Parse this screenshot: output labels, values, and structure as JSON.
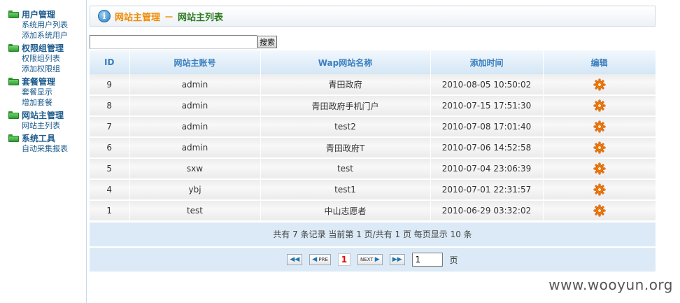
{
  "sidebar": {
    "groups": [
      {
        "title": "用户管理",
        "items": [
          "系统用户列表",
          "添加系统用户"
        ]
      },
      {
        "title": "权限组管理",
        "items": [
          "权限组列表",
          "添加权限组"
        ]
      },
      {
        "title": "套餐管理",
        "items": [
          "套餐显示",
          "增加套餐"
        ]
      },
      {
        "title": "网站主管理",
        "items": [
          "网站主列表"
        ]
      },
      {
        "title": "系统工具",
        "items": [
          "自动采集报表"
        ]
      }
    ]
  },
  "breadcrumb": {
    "section": "网站主管理",
    "separator": "－",
    "page": "网站主列表"
  },
  "search": {
    "value": "",
    "button_label": "搜索"
  },
  "table": {
    "headers": [
      "ID",
      "网站主账号",
      "Wap网站名称",
      "添加时间",
      "编辑"
    ],
    "rows": [
      {
        "id": "9",
        "account": "admin",
        "site": "青田政府",
        "time": "2010-08-05 10:50:02",
        "edit_icon": "gear-icon"
      },
      {
        "id": "8",
        "account": "admin",
        "site": "青田政府手机门户",
        "time": "2010-07-15 17:51:30",
        "edit_icon": "gear-icon"
      },
      {
        "id": "7",
        "account": "admin",
        "site": "test2",
        "time": "2010-07-08 17:01:40",
        "edit_icon": "gear-icon"
      },
      {
        "id": "6",
        "account": "admin",
        "site": "青田政府T",
        "time": "2010-07-06 14:52:58",
        "edit_icon": "gear-icon"
      },
      {
        "id": "5",
        "account": "sxw",
        "site": "test",
        "time": "2010-07-04 23:06:39",
        "edit_icon": "gear-icon"
      },
      {
        "id": "4",
        "account": "ybj",
        "site": "test1",
        "time": "2010-07-01 22:31:57",
        "edit_icon": "gear-icon"
      },
      {
        "id": "1",
        "account": "test",
        "site": "中山志愿者",
        "time": "2010-06-29 03:32:02",
        "edit_icon": "gear-icon"
      }
    ]
  },
  "summary": "共有 7 条记录 当前第 1 页/共有 1 页 每页显示 10 条",
  "pager": {
    "first_label": "",
    "prev_label": "PRE",
    "current_page": "1",
    "next_label": "NEXT",
    "last_label": "",
    "jump_value": "1",
    "unit_label": "页"
  },
  "watermark": "www.wooyun.org",
  "colors": {
    "accent_blue": "#3a7fbf",
    "crumb_orange": "#f08a00",
    "crumb_green": "#2b7a1f",
    "folder_green": "#2e9f2e"
  }
}
